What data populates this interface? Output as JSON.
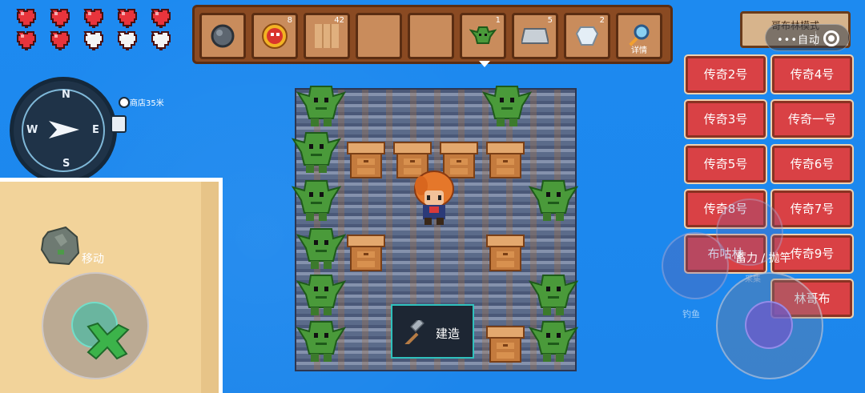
{
  "hud": {
    "hearts": [
      {
        "state": "full",
        "color": "#e8343c"
      },
      {
        "state": "full",
        "color": "#e8343c"
      },
      {
        "state": "full",
        "color": "#e8343c"
      },
      {
        "state": "half",
        "color": "#e8343c"
      },
      {
        "state": "half",
        "color": "#e8343c"
      },
      {
        "state": "half",
        "color": "#e8343c"
      },
      {
        "state": "half",
        "color": "#e8343c"
      },
      {
        "state": "empty",
        "color": "#f4f4f4"
      },
      {
        "state": "empty",
        "color": "#f4f4f4"
      },
      {
        "state": "empty",
        "color": "#f4f4f4"
      }
    ]
  },
  "hotbar": {
    "slots": [
      {
        "icon": "stone-ore-icon",
        "count": ""
      },
      {
        "icon": "demon-shield-icon",
        "count": "8"
      },
      {
        "icon": "wood-plank-icon",
        "count": "42"
      },
      {
        "icon": "empty-slot",
        "count": ""
      },
      {
        "icon": "empty-slot",
        "count": ""
      },
      {
        "icon": "goblin-icon",
        "count": "1"
      },
      {
        "icon": "iron-ingot-icon",
        "count": "5"
      },
      {
        "icon": "crystal-gem-icon",
        "count": "2"
      },
      {
        "icon": "magnifier-icon",
        "count": "",
        "label": "详情"
      }
    ]
  },
  "compass": {
    "n": "N",
    "s": "S",
    "e": "E",
    "w": "W"
  },
  "shop_distance": "商店35米",
  "move_label": "移动",
  "build_label": "建造",
  "mode_button": "哥布林模式",
  "capsule": {
    "dots": "•••",
    "label": "自动"
  },
  "power_label": "蓄力 / 抛竿",
  "fish_label": "钓鱼",
  "pick_label": "采集",
  "legend_buttons": [
    {
      "id": "l2",
      "label": "传奇2号"
    },
    {
      "id": "l4",
      "label": "传奇4号"
    },
    {
      "id": "l3",
      "label": "传奇3号"
    },
    {
      "id": "l1",
      "label": "传奇一号"
    },
    {
      "id": "l5",
      "label": "传奇5号"
    },
    {
      "id": "l6",
      "label": "传奇6号"
    },
    {
      "id": "l8",
      "label": "传奇8号"
    },
    {
      "id": "l7",
      "label": "传奇7号"
    },
    {
      "id": "bg",
      "label": "布咕林"
    },
    {
      "id": "l9",
      "label": "传奇9号"
    },
    {
      "id": "lgb",
      "label": "林哥布"
    }
  ],
  "colors": {
    "ocean": "#1d8af0",
    "sand": "#f2d39a",
    "hotbar_frame": "#8a4a22",
    "legend_button": "#d94145",
    "goblin_green": "#4a9a3a"
  }
}
